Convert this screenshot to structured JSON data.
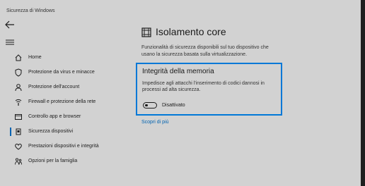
{
  "window": {
    "title": "Sicurezza di Windows"
  },
  "sidebar": {
    "items": [
      {
        "label": "Home",
        "icon": "home-icon"
      },
      {
        "label": "Protezione da virus e minacce",
        "icon": "shield-icon"
      },
      {
        "label": "Protezione dell'account",
        "icon": "person-icon"
      },
      {
        "label": "Firewall e protezione della rete",
        "icon": "wifi-icon"
      },
      {
        "label": "Controllo app e browser",
        "icon": "browser-icon"
      },
      {
        "label": "Sicurezza dispositivi",
        "icon": "device-icon",
        "active": true
      },
      {
        "label": "Prestazioni dispositivi e integrità",
        "icon": "heart-icon"
      },
      {
        "label": "Opzioni per la famiglia",
        "icon": "family-icon"
      }
    ]
  },
  "main": {
    "title": "Isolamento core",
    "description": "Funzionalità di sicurezza disponibili sul tuo dispositivo che usano la sicurezza basata sulla virtualizzazione.",
    "card": {
      "title": "Integrità della memoria",
      "description": "Impedisce agli attacchi l'inserimento di codici dannosi in processi ad alta sicurezza.",
      "toggle_state": "Disattivato",
      "toggle_on": false
    },
    "learn_more": "Scopri di più"
  },
  "colors": {
    "accent": "#0078d7",
    "background": "#d2d2d2",
    "link": "#0063b1"
  }
}
